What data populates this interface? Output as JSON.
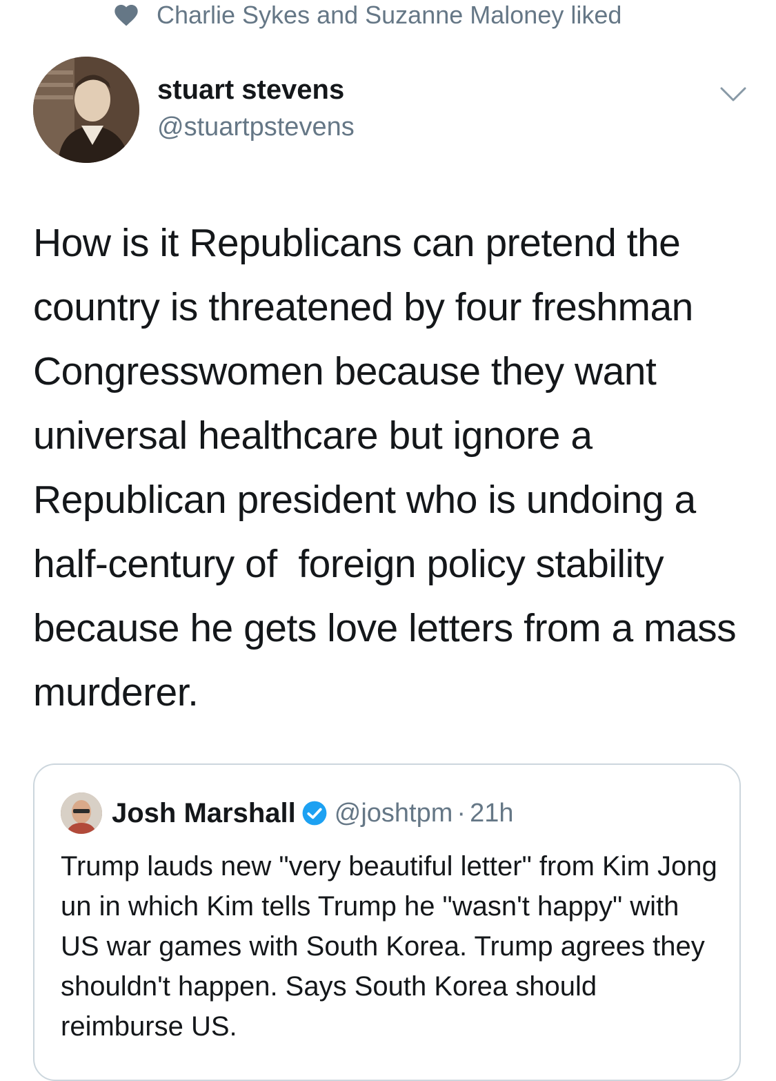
{
  "social_context": {
    "text": "Charlie Sykes and Suzanne Maloney liked",
    "icon": "heart-icon"
  },
  "author": {
    "name": "stuart stevens",
    "handle": "@stuartpstevens"
  },
  "tweet": {
    "text": "How is it Republicans can pretend the country is threatened by four freshman Congresswomen because they want universal healthcare but ignore a Republican president who is undoing a half-century of  foreign policy stability because he gets love letters from a mass murderer."
  },
  "quoted_tweet": {
    "name": "Josh Marshall",
    "verified": true,
    "handle": "@joshtpm",
    "separator": "·",
    "time": "21h",
    "text": "Trump lauds new \"very beautiful letter\" from Kim Jong un in which Kim tells Trump he \"wasn't happy\" with US war games with South Korea. Trump agrees they shouldn't happen. Says South Korea should reimburse US."
  },
  "colors": {
    "primary_text": "#14171a",
    "secondary_text": "#657786",
    "border": "#ccd6dd",
    "verified": "#1da1f2"
  }
}
